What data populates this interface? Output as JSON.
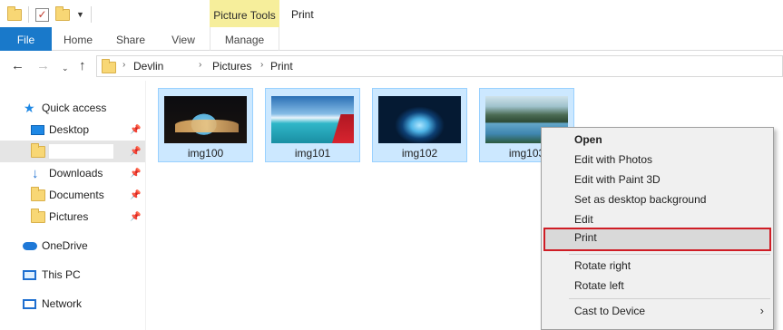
{
  "title_bar": {
    "picture_tools_label": "Picture Tools",
    "window_title": "Print"
  },
  "ribbon": {
    "tabs": [
      {
        "label": "File"
      },
      {
        "label": "Home"
      },
      {
        "label": "Share"
      },
      {
        "label": "View"
      },
      {
        "label": "Manage"
      }
    ]
  },
  "address_bar": {
    "path": [
      "Devlin",
      "Pictures",
      "Print"
    ]
  },
  "nav_pane": {
    "items": [
      {
        "label": "Quick access",
        "icon": "quick-access-star-icon"
      },
      {
        "label": "Desktop",
        "icon": "desktop-icon",
        "pinned": true
      },
      {
        "label": "",
        "icon": "folder-icon",
        "pinned": true,
        "renaming": true
      },
      {
        "label": "Downloads",
        "icon": "downloads-icon",
        "pinned": true
      },
      {
        "label": "Documents",
        "icon": "folder-icon",
        "pinned": true
      },
      {
        "label": "Pictures",
        "icon": "folder-icon",
        "pinned": true
      },
      {
        "label": "OneDrive",
        "icon": "onedrive-icon"
      },
      {
        "label": "This PC",
        "icon": "this-pc-icon"
      },
      {
        "label": "Network",
        "icon": "network-icon"
      }
    ]
  },
  "files": [
    {
      "name": "img100"
    },
    {
      "name": "img101"
    },
    {
      "name": "img102"
    },
    {
      "name": "img103"
    }
  ],
  "context_menu": {
    "items": [
      {
        "label": "Open",
        "bold": true
      },
      {
        "label": "Edit with Photos"
      },
      {
        "label": "Edit with Paint 3D"
      },
      {
        "label": "Set as desktop background"
      },
      {
        "label": "Edit"
      },
      {
        "label": "Print",
        "highlighted": true
      },
      {
        "label": "Rotate right"
      },
      {
        "label": "Rotate left"
      },
      {
        "label": "Cast to Device",
        "submenu": true
      }
    ]
  },
  "colors": {
    "file_tab": "#1979ca",
    "picture_tools": "#f6ee9b",
    "selection": "#cce8ff",
    "highlight_border": "#cf1d25"
  }
}
